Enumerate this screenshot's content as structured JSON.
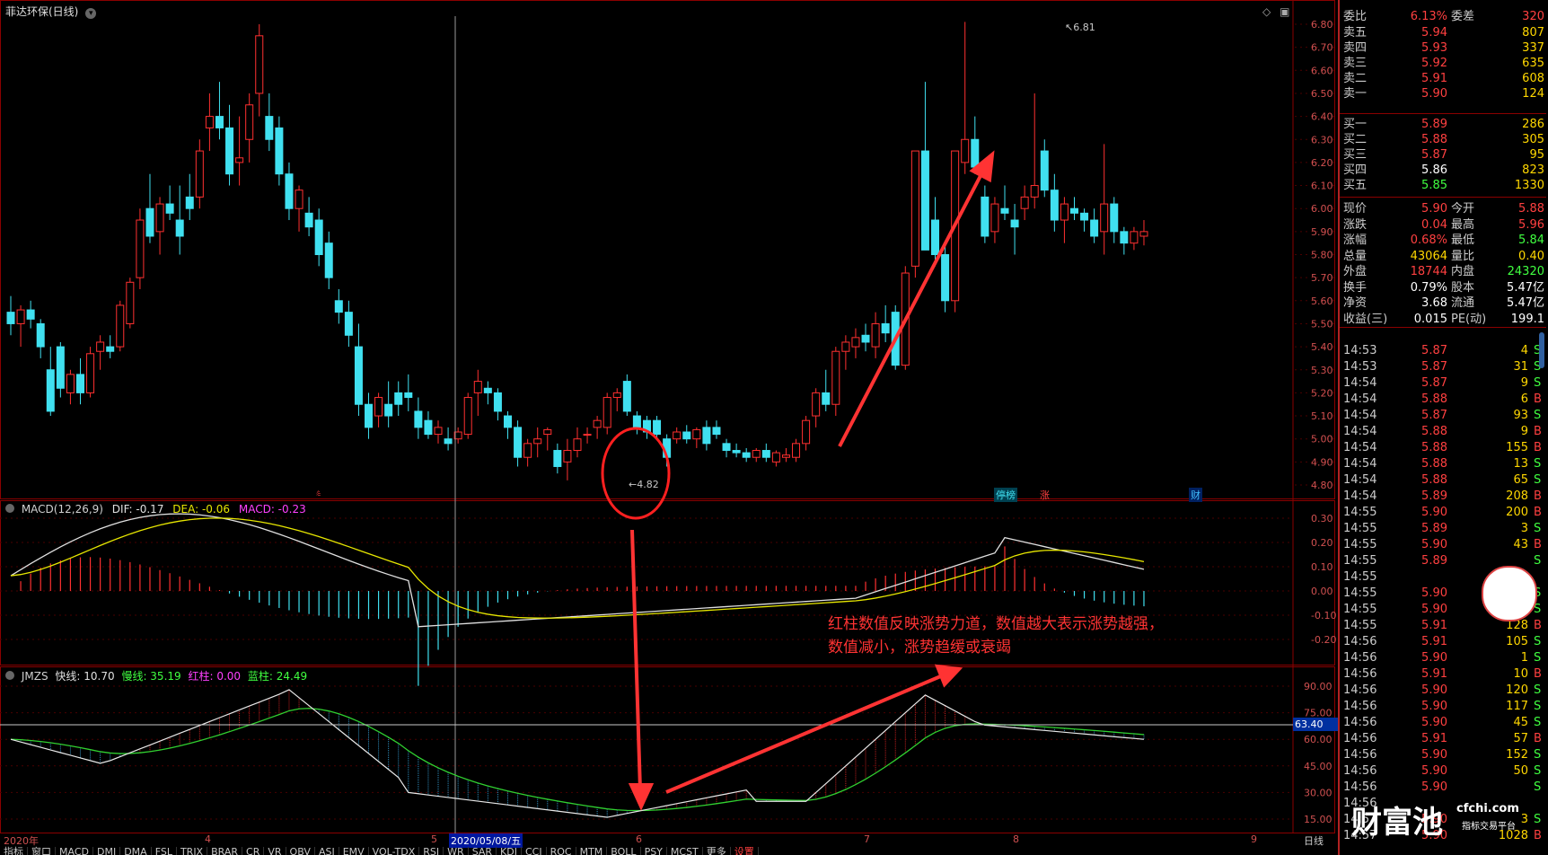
{
  "top": {
    "title": "菲达环保(日线)",
    "high_marker": "6.81",
    "low_marker": "4.82",
    "price_axis": [
      "6.80",
      "6.70",
      "6.60",
      "6.50",
      "6.40",
      "6.30",
      "6.20",
      "6.10",
      "6.00",
      "5.90",
      "5.80",
      "5.70",
      "5.60",
      "5.50",
      "5.40",
      "5.30",
      "5.20",
      "5.10",
      "5.00",
      "4.90",
      "4.80"
    ],
    "badges": {
      "limit": "停榜",
      "rise": "涨",
      "fin": "财"
    }
  },
  "macd": {
    "name": "MACD(12,26,9)",
    "dif": "DIF: -0.17",
    "dea": "DEA: -0.06",
    "macd": "MACD: -0.23",
    "axis": [
      "0.30",
      "0.20",
      "0.10",
      "0.00",
      "-0.10",
      "-0.20"
    ],
    "note_line1": "红柱数值反映涨势力道，数值越大表示涨势越强，",
    "note_line2": "数值减小，涨势趋缓或衰竭"
  },
  "jmzs": {
    "name": "JMZS",
    "fast": "快线: 10.70",
    "slow": "慢线: 35.19",
    "redbar": "红柱: 0.00",
    "bluebar": "蓝柱: 24.49",
    "axis": [
      "90.00",
      "75.00",
      "60.00",
      "45.00",
      "30.00",
      "15.00"
    ],
    "current": "63.40"
  },
  "xaxis": {
    "labels": [
      "2020年",
      "4",
      "5",
      "6",
      "7",
      "8",
      "9"
    ],
    "date_label": "2020/05/08/五",
    "right_label": "日线"
  },
  "tabs": [
    "指标",
    "窗口",
    "MACD",
    "DMI",
    "DMA",
    "FSL",
    "TRIX",
    "BRAR",
    "CR",
    "VR",
    "OBV",
    "ASI",
    "EMV",
    "VOL-TDX",
    "RSI",
    "WR",
    "SAR",
    "KDJ",
    "CCI",
    "ROC",
    "MTM",
    "BOLL",
    "PSY",
    "MCST",
    "更多",
    "设置"
  ],
  "quote": {
    "weibi": {
      "label": "委比",
      "value": "6.13%",
      "label2": "委差",
      "value2": "320"
    },
    "asks": [
      {
        "label": "卖五",
        "price": "5.94",
        "vol": "807"
      },
      {
        "label": "卖四",
        "price": "5.93",
        "vol": "337"
      },
      {
        "label": "卖三",
        "price": "5.92",
        "vol": "635"
      },
      {
        "label": "卖二",
        "price": "5.91",
        "vol": "608"
      },
      {
        "label": "卖一",
        "price": "5.90",
        "vol": "124"
      }
    ],
    "bids": [
      {
        "label": "买一",
        "price": "5.89",
        "vol": "286"
      },
      {
        "label": "买二",
        "price": "5.88",
        "vol": "305"
      },
      {
        "label": "买三",
        "price": "5.87",
        "vol": "95"
      },
      {
        "label": "买四",
        "price": "5.86",
        "vol": "823"
      },
      {
        "label": "买五",
        "price": "5.85",
        "vol": "1330"
      }
    ],
    "stats": [
      {
        "l1": "现价",
        "v1": "5.90",
        "l2": "今开",
        "v2": "5.88"
      },
      {
        "l1": "涨跌",
        "v1": "0.04",
        "l2": "最高",
        "v2": "5.96"
      },
      {
        "l1": "涨幅",
        "v1": "0.68%",
        "l2": "最低",
        "v2": "5.84"
      },
      {
        "l1": "总量",
        "v1": "43064",
        "l2": "量比",
        "v2": "0.40"
      },
      {
        "l1": "外盘",
        "v1": "18744",
        "l2": "内盘",
        "v2": "24320"
      },
      {
        "l1": "换手",
        "v1": "0.79%",
        "l2": "股本",
        "v2": "5.47亿"
      },
      {
        "l1": "净资",
        "v1": "3.68",
        "l2": "流通",
        "v2": "5.47亿"
      },
      {
        "l1": "收益(三)",
        "v1": "0.015",
        "l2": "PE(动)",
        "v2": "199.1"
      }
    ],
    "trades": [
      {
        "t": "14:53",
        "p": "5.87",
        "v": "4",
        "d": "S"
      },
      {
        "t": "14:53",
        "p": "5.87",
        "v": "31",
        "d": "S"
      },
      {
        "t": "14:54",
        "p": "5.87",
        "v": "9",
        "d": "S"
      },
      {
        "t": "14:54",
        "p": "5.88",
        "v": "6",
        "d": "B"
      },
      {
        "t": "14:54",
        "p": "5.87",
        "v": "93",
        "d": "S"
      },
      {
        "t": "14:54",
        "p": "5.88",
        "v": "9",
        "d": "B"
      },
      {
        "t": "14:54",
        "p": "5.88",
        "v": "155",
        "d": "B"
      },
      {
        "t": "14:54",
        "p": "5.88",
        "v": "13",
        "d": "S"
      },
      {
        "t": "14:54",
        "p": "5.88",
        "v": "65",
        "d": "S"
      },
      {
        "t": "14:54",
        "p": "5.89",
        "v": "208",
        "d": "B"
      },
      {
        "t": "14:55",
        "p": "5.90",
        "v": "200",
        "d": "B"
      },
      {
        "t": "14:55",
        "p": "5.89",
        "v": "3",
        "d": "S"
      },
      {
        "t": "14:55",
        "p": "5.90",
        "v": "43",
        "d": "B"
      },
      {
        "t": "14:55",
        "p": "5.89",
        "v": "",
        "d": "S"
      },
      {
        "t": "14:55",
        "p": "",
        "v": "",
        "d": ""
      },
      {
        "t": "14:55",
        "p": "5.90",
        "v": "",
        "d": "S"
      },
      {
        "t": "14:55",
        "p": "5.90",
        "v": "",
        "d": "S"
      },
      {
        "t": "14:55",
        "p": "5.91",
        "v": "128",
        "d": "B"
      },
      {
        "t": "14:56",
        "p": "5.91",
        "v": "105",
        "d": "S"
      },
      {
        "t": "14:56",
        "p": "5.90",
        "v": "1",
        "d": "S"
      },
      {
        "t": "14:56",
        "p": "5.91",
        "v": "10",
        "d": "B"
      },
      {
        "t": "14:56",
        "p": "5.90",
        "v": "120",
        "d": "S"
      },
      {
        "t": "14:56",
        "p": "5.90",
        "v": "117",
        "d": "S"
      },
      {
        "t": "14:56",
        "p": "5.90",
        "v": "45",
        "d": "S"
      },
      {
        "t": "14:56",
        "p": "5.91",
        "v": "57",
        "d": "B"
      },
      {
        "t": "14:56",
        "p": "5.90",
        "v": "152",
        "d": "S"
      },
      {
        "t": "14:56",
        "p": "5.90",
        "v": "50",
        "d": "S"
      },
      {
        "t": "14:56",
        "p": "5.90",
        "v": "",
        "d": "S"
      },
      {
        "t": "14:56",
        "p": "",
        "v": "",
        "d": ""
      },
      {
        "t": "14:57",
        "p": "5.90",
        "v": "3",
        "d": "S"
      },
      {
        "t": "14:57",
        "p": "5.90",
        "v": "1028",
        "d": "B"
      }
    ]
  },
  "watermark": {
    "brand": "财富池",
    "site": "cfchi.com",
    "sub": "指标交易平台"
  },
  "colors": {
    "up": "#ff3030",
    "down": "#40e0f0",
    "bg": "#000000",
    "grid": "#8b0000",
    "annotation": "#ff3333"
  }
}
